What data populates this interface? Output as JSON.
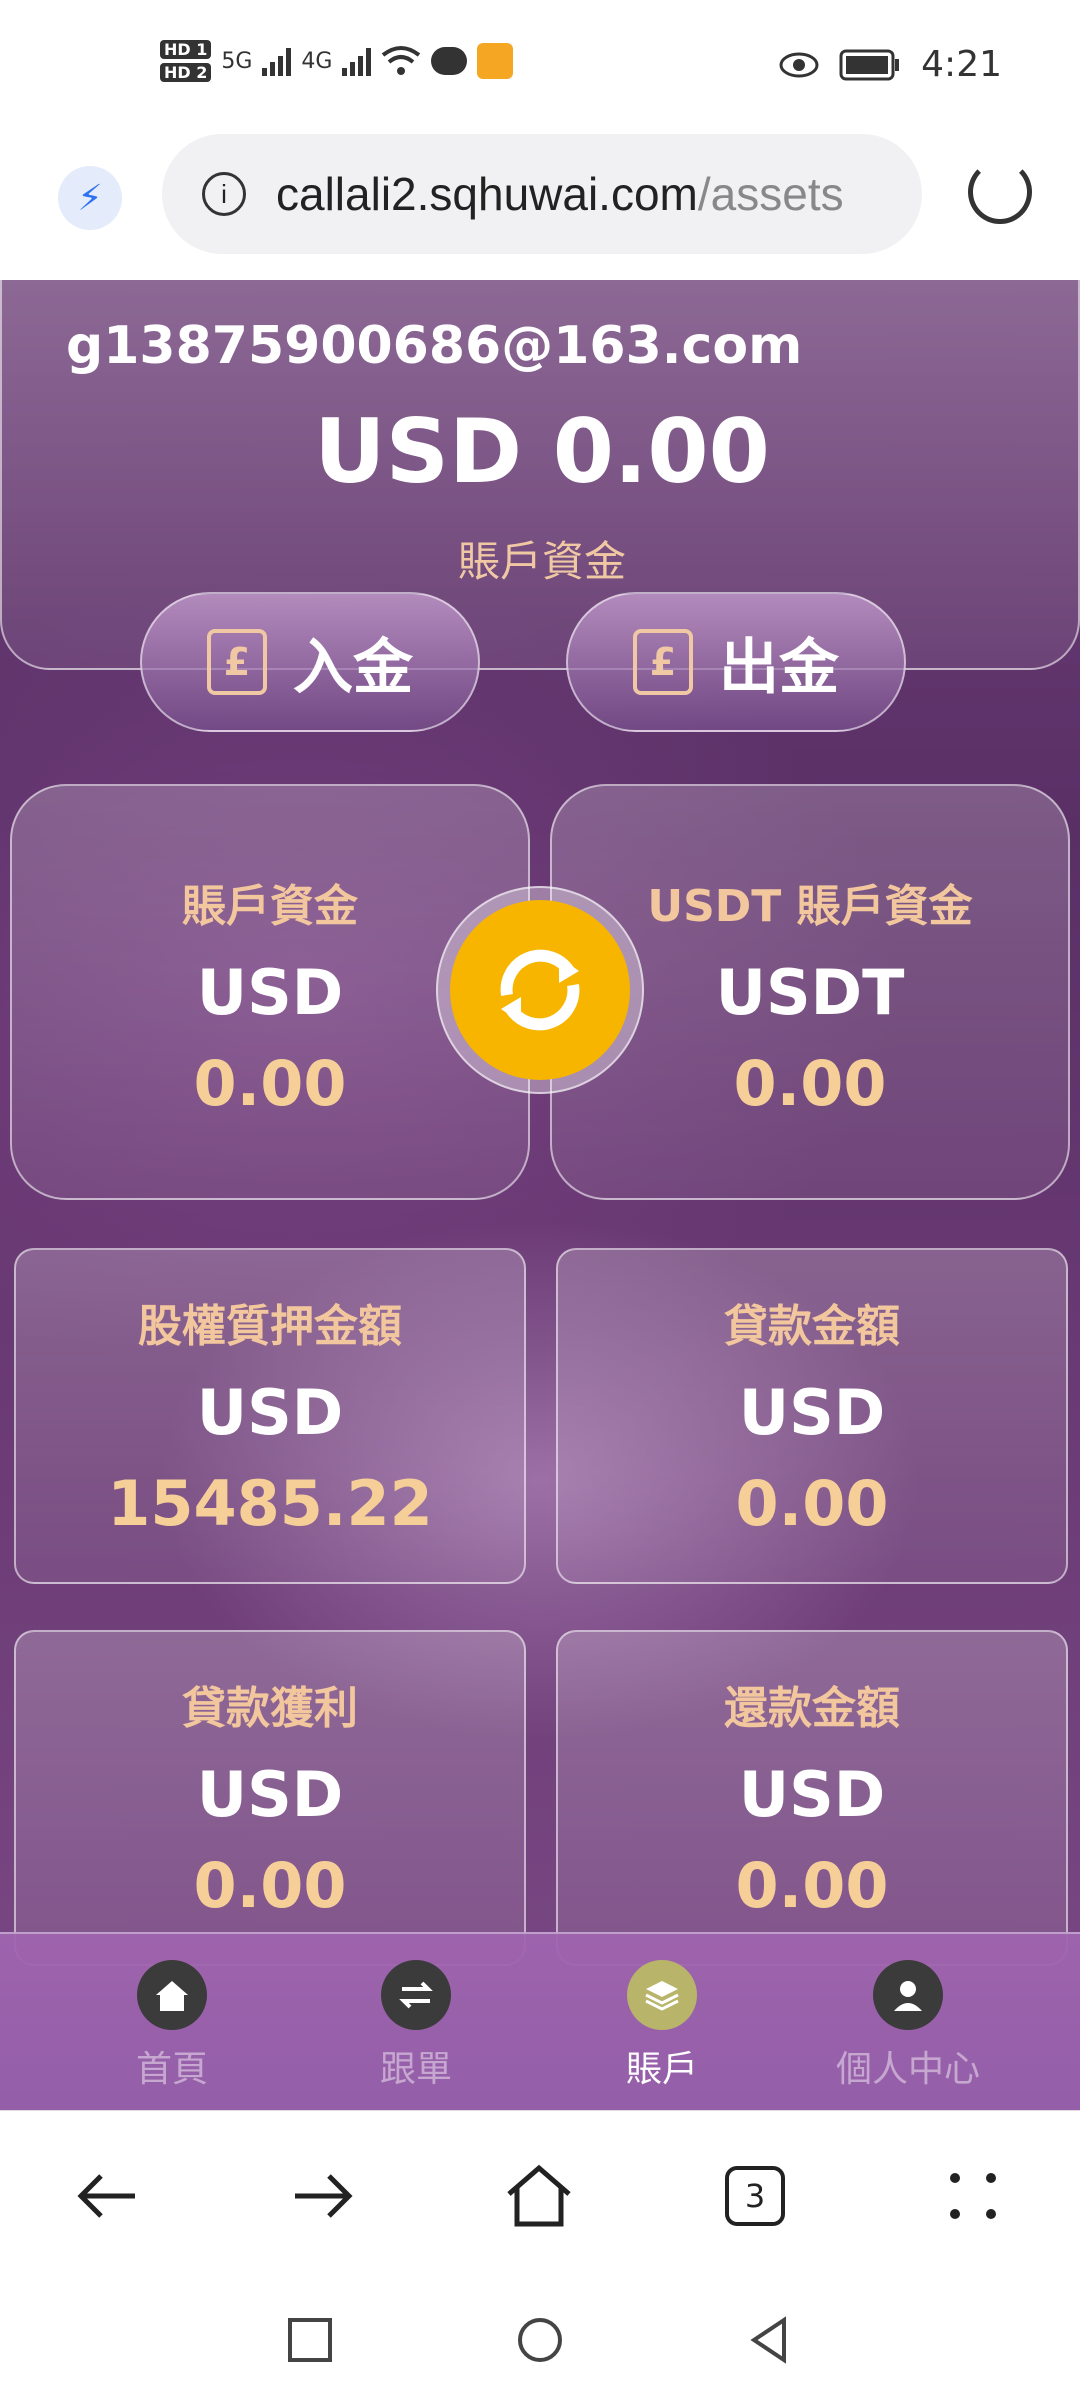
{
  "status_bar": {
    "hd1": "HD 1",
    "hd2": "HD 2",
    "net1": "5G",
    "net2": "4G",
    "time": "4:21"
  },
  "browser": {
    "url_host": "callali2.sqhuwai.com",
    "url_path": "/assets",
    "tab_count": "3"
  },
  "account": {
    "email": "g13875900686@163.com",
    "total": "USD 0.00",
    "total_label": "賬戶資金",
    "deposit_label": "入金",
    "withdraw_label": "出金"
  },
  "cards": [
    {
      "title": "賬戶資金",
      "currency": "USD",
      "amount": "0.00"
    },
    {
      "title": "USDT 賬戶資金",
      "currency": "USDT",
      "amount": "0.00"
    },
    {
      "title": "股權質押金額",
      "currency": "USD",
      "amount": "15485.22"
    },
    {
      "title": "貸款金額",
      "currency": "USD",
      "amount": "0.00"
    },
    {
      "title": "貸款獲利",
      "currency": "USD",
      "amount": "0.00"
    },
    {
      "title": "還款金額",
      "currency": "USD",
      "amount": "0.00"
    }
  ],
  "tabbar": [
    {
      "label": "首頁",
      "icon": "home-icon"
    },
    {
      "label": "跟單",
      "icon": "swap-icon"
    },
    {
      "label": "賬戶",
      "icon": "layers-icon",
      "active": true
    },
    {
      "label": "個人中心",
      "icon": "user-icon"
    }
  ],
  "colors": {
    "accent_gold": "#f7b500",
    "label_peach": "#f3c79d",
    "background_purple": "#6d3f78"
  }
}
